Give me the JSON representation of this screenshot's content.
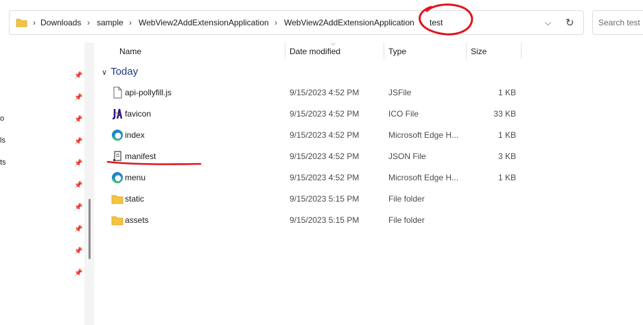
{
  "breadcrumb": [
    "Downloads",
    "sample",
    "WebView2AddExtensionApplication",
    "WebView2AddExtensionApplication",
    "test"
  ],
  "search": {
    "placeholder": "Search test"
  },
  "columns": {
    "name": "Name",
    "date": "Date modified",
    "type": "Type",
    "size": "Size"
  },
  "left_fragments": [
    "o",
    "ls",
    "ts"
  ],
  "group": {
    "label": "Today"
  },
  "files": [
    {
      "name": "api-pollyfill.js",
      "date": "9/15/2023 4:52 PM",
      "type": "JSFile",
      "size": "1 KB",
      "icon": "js-file-icon"
    },
    {
      "name": "favicon",
      "date": "9/15/2023 4:52 PM",
      "type": "ICO File",
      "size": "33 KB",
      "icon": "ico-file-icon"
    },
    {
      "name": "index",
      "date": "9/15/2023 4:52 PM",
      "type": "Microsoft Edge H...",
      "size": "1 KB",
      "icon": "edge-html-icon"
    },
    {
      "name": "manifest",
      "date": "9/15/2023 4:52 PM",
      "type": "JSON File",
      "size": "3 KB",
      "icon": "json-file-icon"
    },
    {
      "name": "menu",
      "date": "9/15/2023 4:52 PM",
      "type": "Microsoft Edge H...",
      "size": "1 KB",
      "icon": "edge-html-icon"
    },
    {
      "name": "static",
      "date": "9/15/2023 5:15 PM",
      "type": "File folder",
      "size": "",
      "icon": "folder-icon"
    },
    {
      "name": "assets",
      "date": "9/15/2023 5:15 PM",
      "type": "File folder",
      "size": "",
      "icon": "folder-icon"
    }
  ],
  "colors": {
    "folder": "#f5c342",
    "edge": "#1e88c8",
    "annotation": "#e0141e",
    "group": "#1e3a8a"
  }
}
